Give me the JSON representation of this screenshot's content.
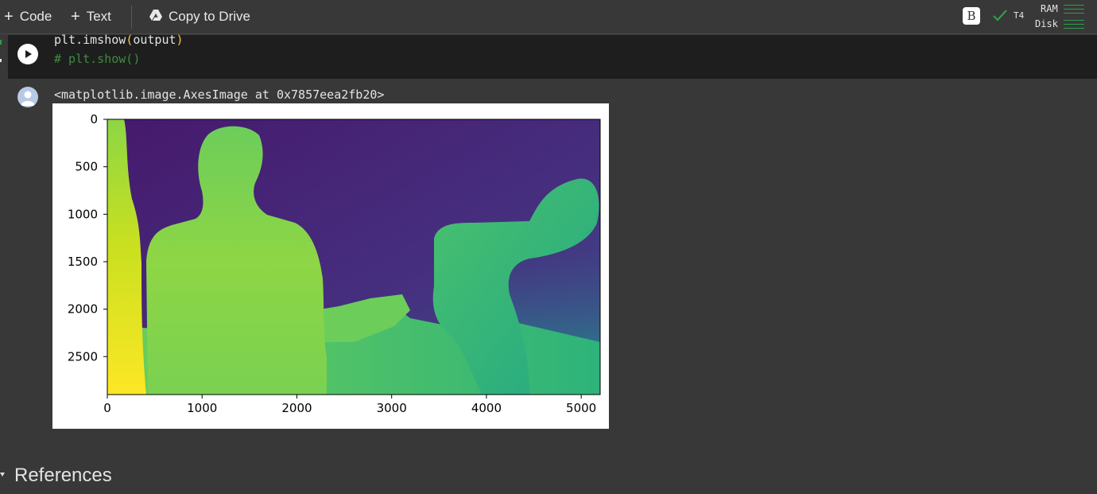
{
  "toolbar": {
    "code_label": "Code",
    "text_label": "Text",
    "copy_to_drive_label": "Copy to Drive",
    "account_badge": "B",
    "runtime_label": "T4",
    "ram_label": "RAM",
    "disk_label": "Disk"
  },
  "cell": {
    "code_line1_a": "plt.imshow",
    "code_line1_b": "(",
    "code_line1_c": "output",
    "code_line1_d": ")",
    "code_line2": "# plt.show()"
  },
  "output": {
    "text": "<matplotlib.image.AxesImage at 0x7857eea2fb20>"
  },
  "chart_data": {
    "type": "heatmap",
    "title": "",
    "xlabel": "",
    "ylabel": "",
    "colormap": "viridis",
    "xlim": [
      0,
      5200
    ],
    "ylim": [
      2900,
      0
    ],
    "x_ticks": [
      "0",
      "1000",
      "2000",
      "3000",
      "4000",
      "5000"
    ],
    "y_ticks": [
      "0",
      "500",
      "1000",
      "1500",
      "2000",
      "2500"
    ],
    "x_tick_values": [
      0,
      1000,
      2000,
      3000,
      4000,
      5000
    ],
    "y_tick_values": [
      0,
      500,
      1000,
      1500,
      2000,
      2500
    ]
  },
  "sections": {
    "references_label": "References"
  },
  "colors": {
    "background": "#383838",
    "code_background": "#1e1e1e",
    "accent_green": "#2e9d4b",
    "comment_green": "#3d8c40",
    "paren_yellow": "#f7c744"
  }
}
